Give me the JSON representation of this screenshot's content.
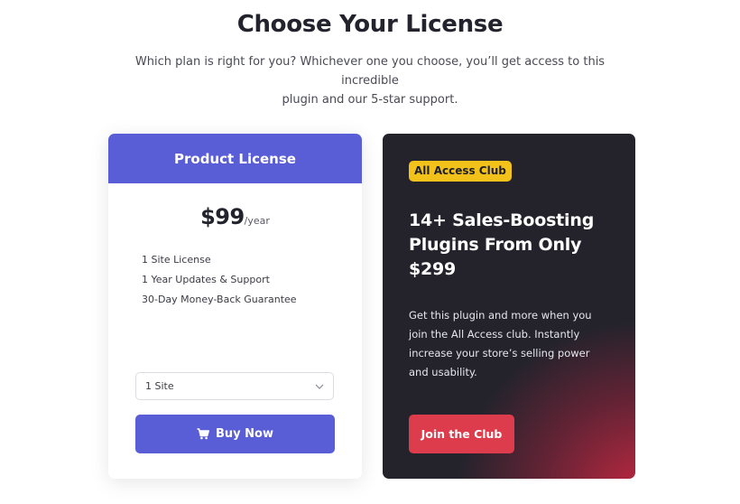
{
  "page": {
    "title": "Choose Your License",
    "subtitle_line1": "Which plan is right for you? Whichever one you choose, you’ll get access to this incredible",
    "subtitle_line2": "plugin and our 5-star support."
  },
  "product_license": {
    "header": "Product License",
    "price": "$99",
    "period": "/year",
    "features": [
      "1 Site License",
      "1 Year Updates & Support",
      "30-Day Money-Back Guarantee"
    ],
    "site_select": {
      "selected": "1 Site"
    },
    "buy_button": {
      "label": "Buy Now",
      "icon": "cart-icon"
    }
  },
  "all_access": {
    "badge": "All Access Club",
    "title": "14+ Sales-Boosting Plugins From Only $299",
    "description": "Get this plugin and more when you join the All Access club. Instantly increase your store’s selling power and usability.",
    "button": "Join the Club"
  },
  "colors": {
    "primary": "#5a5ed6",
    "dark_card": "#24232c",
    "badge": "#f2c21b",
    "accent_red": "#dc3c4b"
  }
}
